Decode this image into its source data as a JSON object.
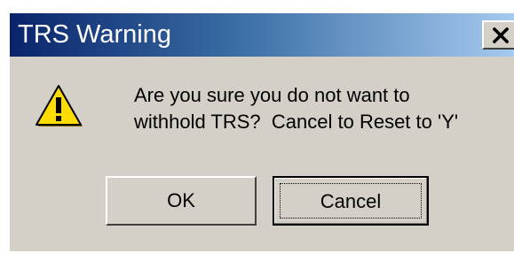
{
  "window": {
    "title": "TRS Warning",
    "close_label": "×"
  },
  "message": {
    "line1": "Are you sure you do not want to",
    "line2": "withhold TRS?  Cancel to Reset to 'Y'"
  },
  "buttons": {
    "ok_label": "OK",
    "cancel_label": "Cancel"
  },
  "icon": "warning-icon",
  "colors": {
    "title_start": "#0a246a",
    "title_end": "#a6caf0",
    "face": "#d4d0c8",
    "warning_yellow": "#ffdc00"
  }
}
